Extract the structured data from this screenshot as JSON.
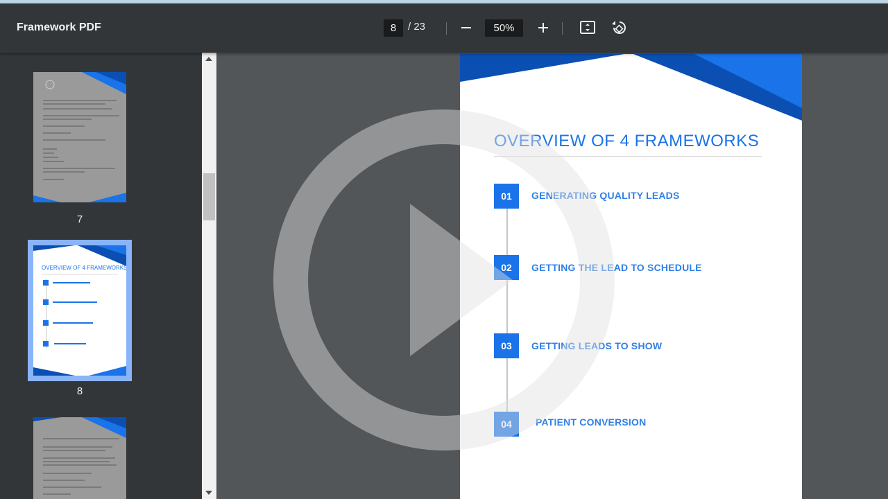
{
  "toolbar": {
    "title": "Framework PDF",
    "current_page": "8",
    "page_total": "/ 23",
    "zoom": "50%",
    "icons": [
      "minus-icon",
      "plus-icon",
      "fit-page-icon",
      "rotate-icon"
    ]
  },
  "sidebar": {
    "thumbnails": [
      {
        "label": "7"
      },
      {
        "label": "8",
        "title": "OVERVIEW OF 4 FRAMEWORKS",
        "selected": true
      },
      {
        "label": ""
      }
    ]
  },
  "page": {
    "title": "OVERVIEW OF 4 FRAMEWORKS",
    "steps": [
      {
        "num": "01",
        "text": "GENERATING QUALITY LEADS"
      },
      {
        "num": "02",
        "text": "GETTING THE LEAD TO SCHEDULE"
      },
      {
        "num": "03",
        "text": "GETTING LEADS TO SHOW"
      },
      {
        "num": "04",
        "text": "PATIENT CONVERSION"
      }
    ]
  },
  "colors": {
    "toolbar": "#323639",
    "viewer": "#525659",
    "accent_blue": "#1a73e8",
    "dark_blue": "#0b4fb3",
    "selection": "#8ab4f8"
  },
  "overlay": {
    "icon": "play-icon"
  }
}
